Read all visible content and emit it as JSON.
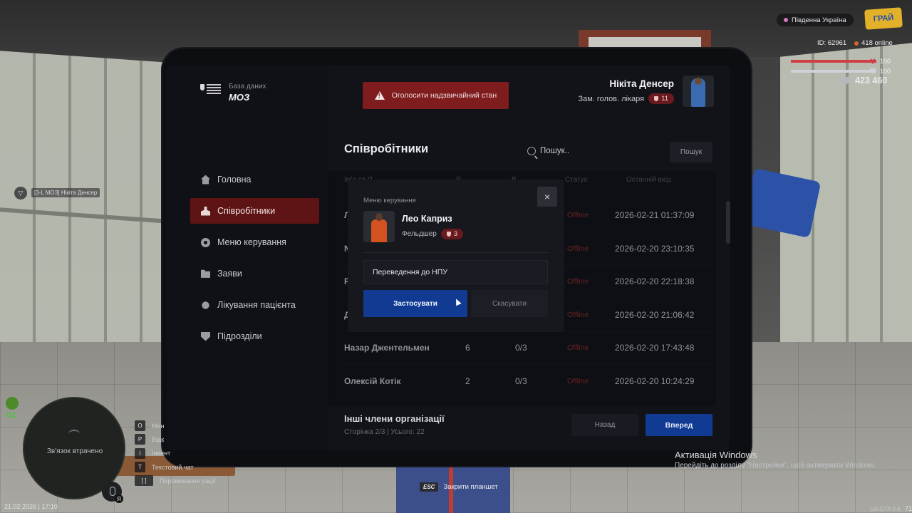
{
  "hud": {
    "server": "Південна Україна",
    "logo_text": "ГРАЙ",
    "player_id": "ID: 62961",
    "online": "418 online",
    "health": 100,
    "health_label": "100",
    "armor": 100,
    "armor_label": "100",
    "money": "423 460",
    "zone_badge": "GZ",
    "minimap_status": "Зв'язок втрачено",
    "mic_key": "Я",
    "datetime": "21.02.2026 | 17:10",
    "map_tag": "[3-L МОЗ] Нікіта Денсер",
    "hotkeys": [
      {
        "key": "O",
        "label": "Мен"
      },
      {
        "key": "P",
        "label": "Відк"
      },
      {
        "key": "I",
        "label": "Інвент"
      },
      {
        "key": "T",
        "label": "Текстовий чат"
      },
      {
        "key": "[ ]",
        "label": "Перемикання рації"
      }
    ],
    "esc_key": "ESC",
    "esc_label": "Закрити планшет",
    "windows_title": "Активація Windows",
    "windows_sub": "Перейдіть до розділу \"Настройки\", щоб активувати Windows.",
    "version": "UA-GTA 3.6",
    "corner_num": "71"
  },
  "tablet": {
    "brand_sub": "База даних",
    "brand_main": "МОЗ",
    "emergency_label": "Оголосити надзвичайний стан",
    "user": {
      "name": "Нікіта Денсер",
      "role": "Зам. голов. лікаря",
      "rank": "11"
    },
    "nav": [
      {
        "label": "Головна",
        "icon": "home-icon",
        "active": false
      },
      {
        "label": "Співробітники",
        "icon": "users-icon",
        "active": true
      },
      {
        "label": "Меню керування",
        "icon": "gear-icon",
        "active": false
      },
      {
        "label": "Заяви",
        "icon": "folder-icon",
        "active": false
      },
      {
        "label": "Лікування пацієнта",
        "icon": "sun-icon",
        "active": false
      },
      {
        "label": "Підрозділи",
        "icon": "shield-icon",
        "active": false
      }
    ],
    "section_title": "Співробітники",
    "search_placeholder": "Пошук..",
    "search_button": "Пошук",
    "columns": {
      "name": "Ім'я та П",
      "rank": "Р",
      "warns": "В",
      "status": "Статус",
      "last_login": "Останній вхід"
    },
    "rows": [
      {
        "name": "Л",
        "rank": "",
        "warns": "",
        "status": "Offline",
        "last_login": "2026-02-21 01:37:09"
      },
      {
        "name": "N",
        "rank": "",
        "warns": "",
        "status": "Offline",
        "last_login": "2026-02-20 23:10:35"
      },
      {
        "name": "P",
        "rank": "",
        "warns": "",
        "status": "Offline",
        "last_login": "2026-02-20 22:18:38"
      },
      {
        "name": "Д",
        "rank": "",
        "warns": "",
        "status": "Offline",
        "last_login": "2026-02-20 21:06:42"
      },
      {
        "name": "Назар Джентельмен",
        "rank": "6",
        "warns": "0/3",
        "status": "Offline",
        "last_login": "2026-02-20 17:43:48"
      },
      {
        "name": "Олексій Котік",
        "rank": "2",
        "warns": "0/3",
        "status": "Offline",
        "last_login": "2026-02-20 10:24:29"
      }
    ],
    "footer_title": "Інші члени організації",
    "footer_sub": "Сторінка 2/3 | Усього: 22",
    "btn_back": "Назад",
    "btn_next": "Вперед"
  },
  "modal": {
    "label": "Меню керування",
    "close": "×",
    "name": "Лео Каприз",
    "role": "Фельдшер",
    "rank": "3",
    "action": "Переведення до НПУ",
    "apply": "Застосувати",
    "cancel": "Скасувати"
  },
  "colors": {
    "accent_blue": "#113b92",
    "accent_red": "#7e1c1e",
    "offline": "#9c2f2f",
    "health": "#d23d44",
    "armor": "#cfd1d6"
  }
}
